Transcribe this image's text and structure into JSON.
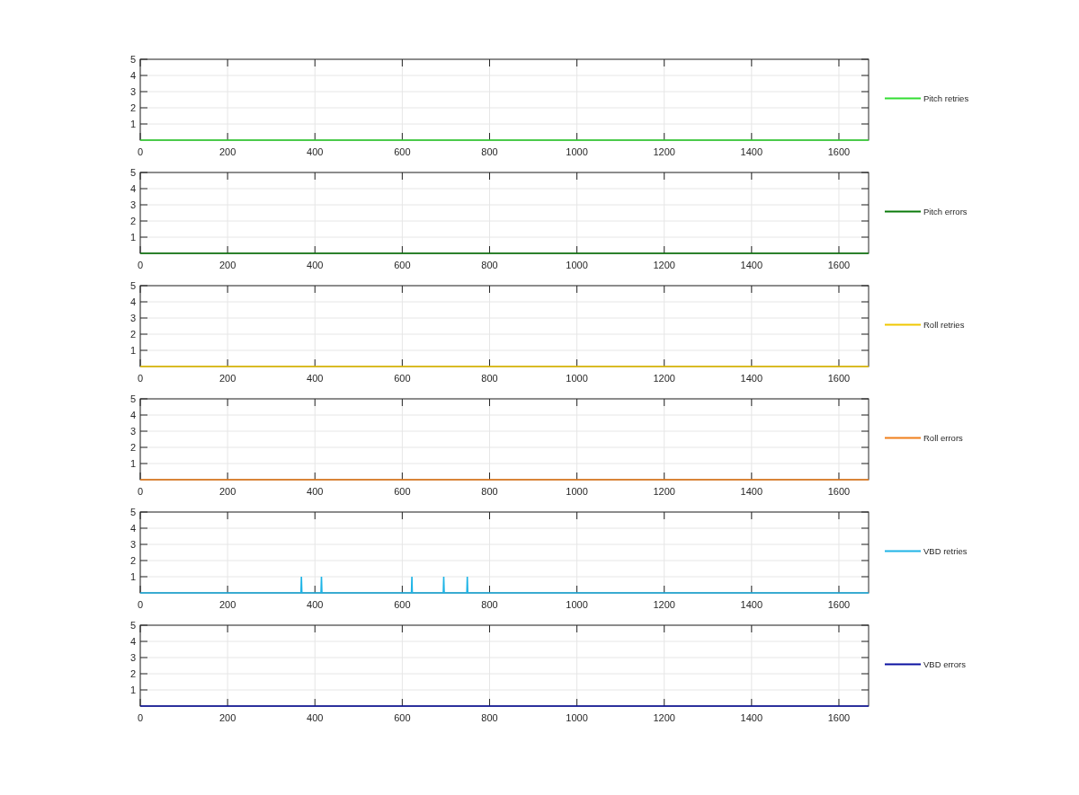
{
  "subplots": [
    {
      "chart_data": {
        "type": "line",
        "x": [
          0,
          368,
          369,
          370,
          414,
          415,
          416,
          621,
          622,
          623,
          694,
          695,
          696,
          748,
          749,
          750,
          1668
        ],
        "xlim": [
          0,
          1668
        ],
        "ylim": [
          0,
          5
        ],
        "xticks": [
          0,
          200,
          400,
          600,
          800,
          1000,
          1200,
          1400,
          1600
        ],
        "yticks": [
          1,
          2,
          3,
          4,
          5
        ],
        "grid": true,
        "series": [
          {
            "name": "Pitch retries",
            "color": "#33dd33",
            "values": [
              0,
              0,
              0,
              0,
              0,
              0,
              0,
              0,
              0,
              0,
              0,
              0,
              0,
              0,
              0,
              0,
              0
            ]
          }
        ]
      }
    },
    {
      "chart_data": {
        "type": "line",
        "x": [
          0,
          368,
          369,
          370,
          414,
          415,
          416,
          621,
          622,
          623,
          694,
          695,
          696,
          748,
          749,
          750,
          1668
        ],
        "xlim": [
          0,
          1668
        ],
        "ylim": [
          0,
          5
        ],
        "xticks": [
          0,
          200,
          400,
          600,
          800,
          1000,
          1200,
          1400,
          1600
        ],
        "yticks": [
          1,
          2,
          3,
          4,
          5
        ],
        "grid": true,
        "series": [
          {
            "name": "Pitch errors",
            "color": "#0a7a0a",
            "values": [
              0,
              0,
              0,
              0,
              0,
              0,
              0,
              0,
              0,
              0,
              0,
              0,
              0,
              0,
              0,
              0,
              0
            ]
          }
        ]
      }
    },
    {
      "chart_data": {
        "type": "line",
        "x": [
          0,
          368,
          369,
          370,
          414,
          415,
          416,
          621,
          622,
          623,
          694,
          695,
          696,
          748,
          749,
          750,
          1668
        ],
        "xlim": [
          0,
          1668
        ],
        "ylim": [
          0,
          5
        ],
        "xticks": [
          0,
          200,
          400,
          600,
          800,
          1000,
          1200,
          1400,
          1600
        ],
        "yticks": [
          1,
          2,
          3,
          4,
          5
        ],
        "grid": true,
        "series": [
          {
            "name": "Roll retries",
            "color": "#f0c800",
            "values": [
              0,
              0,
              0,
              0,
              0,
              0,
              0,
              0,
              0,
              0,
              0,
              0,
              0,
              0,
              0,
              0,
              0
            ]
          }
        ]
      }
    },
    {
      "chart_data": {
        "type": "line",
        "x": [
          0,
          368,
          369,
          370,
          414,
          415,
          416,
          621,
          622,
          623,
          694,
          695,
          696,
          748,
          749,
          750,
          1668
        ],
        "xlim": [
          0,
          1668
        ],
        "ylim": [
          0,
          5
        ],
        "xticks": [
          0,
          200,
          400,
          600,
          800,
          1000,
          1200,
          1400,
          1600
        ],
        "yticks": [
          1,
          2,
          3,
          4,
          5
        ],
        "grid": true,
        "series": [
          {
            "name": "Roll errors",
            "color": "#f07f1a",
            "values": [
              0,
              0,
              0,
              0,
              0,
              0,
              0,
              0,
              0,
              0,
              0,
              0,
              0,
              0,
              0,
              0,
              0
            ]
          }
        ]
      }
    },
    {
      "chart_data": {
        "type": "line",
        "x": [
          0,
          368,
          369,
          370,
          414,
          415,
          416,
          621,
          622,
          623,
          694,
          695,
          696,
          748,
          749,
          750,
          1668
        ],
        "xlim": [
          0,
          1668
        ],
        "ylim": [
          0,
          5
        ],
        "xticks": [
          0,
          200,
          400,
          600,
          800,
          1000,
          1200,
          1400,
          1600
        ],
        "yticks": [
          1,
          2,
          3,
          4,
          5
        ],
        "grid": true,
        "series": [
          {
            "name": "VBD retries",
            "color": "#1eb4e6",
            "values": [
              0,
              0,
              1,
              0,
              0,
              1,
              0,
              0,
              1,
              0,
              0,
              1,
              0,
              0,
              1,
              0,
              0
            ]
          }
        ]
      }
    },
    {
      "chart_data": {
        "type": "line",
        "x": [
          0,
          368,
          369,
          370,
          414,
          415,
          416,
          621,
          622,
          623,
          694,
          695,
          696,
          748,
          749,
          750,
          1668
        ],
        "xlim": [
          0,
          1668
        ],
        "ylim": [
          0,
          5
        ],
        "xticks": [
          0,
          200,
          400,
          600,
          800,
          1000,
          1200,
          1400,
          1600
        ],
        "yticks": [
          1,
          2,
          3,
          4,
          5
        ],
        "grid": true,
        "series": [
          {
            "name": "VBD errors",
            "color": "#0a10a0",
            "values": [
              0,
              0,
              0,
              0,
              0,
              0,
              0,
              0,
              0,
              0,
              0,
              0,
              0,
              0,
              0,
              0,
              0
            ]
          }
        ]
      }
    }
  ]
}
